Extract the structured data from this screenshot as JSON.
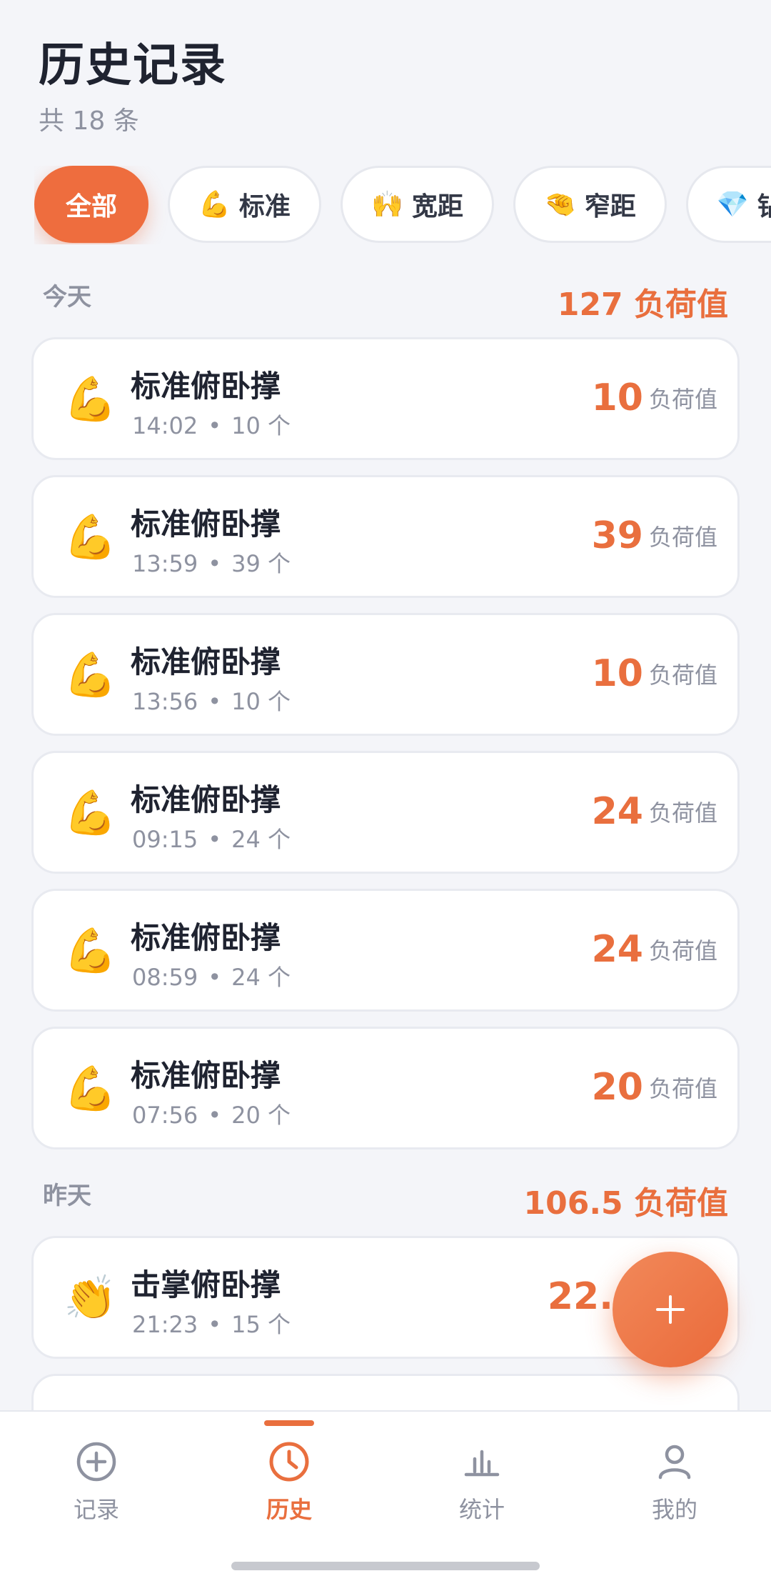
{
  "header": {
    "title": "历史记录",
    "subtitle": "共 18 条"
  },
  "filters": [
    {
      "label": "全部",
      "emoji": ""
    },
    {
      "label": "标准",
      "emoji": "💪"
    },
    {
      "label": "宽距",
      "emoji": "🙌"
    },
    {
      "label": "窄距",
      "emoji": "🤏"
    },
    {
      "label": "钻",
      "emoji": "💎"
    }
  ],
  "groups": [
    {
      "label": "今天",
      "total": "127 负荷值",
      "records": [
        {
          "emoji": "💪",
          "name": "标准俯卧撑",
          "time": "14:02",
          "count": "10 个",
          "value": "10",
          "unit": "负荷值"
        },
        {
          "emoji": "💪",
          "name": "标准俯卧撑",
          "time": "13:59",
          "count": "39 个",
          "value": "39",
          "unit": "负荷值"
        },
        {
          "emoji": "💪",
          "name": "标准俯卧撑",
          "time": "13:56",
          "count": "10 个",
          "value": "10",
          "unit": "负荷值"
        },
        {
          "emoji": "💪",
          "name": "标准俯卧撑",
          "time": "09:15",
          "count": "24 个",
          "value": "24",
          "unit": "负荷值"
        },
        {
          "emoji": "💪",
          "name": "标准俯卧撑",
          "time": "08:59",
          "count": "24 个",
          "value": "24",
          "unit": "负荷值"
        },
        {
          "emoji": "💪",
          "name": "标准俯卧撑",
          "time": "07:56",
          "count": "20 个",
          "value": "20",
          "unit": "负荷值"
        }
      ]
    },
    {
      "label": "昨天",
      "total": "106.5 负荷值",
      "records": [
        {
          "emoji": "👏",
          "name": "击掌俯卧撑",
          "time": "21:23",
          "count": "15 个",
          "value": "22.",
          "unit": ""
        }
      ]
    }
  ],
  "separator": "•",
  "fab": {
    "icon": "plus-icon"
  },
  "tabbar": {
    "tabs": [
      {
        "label": "记录",
        "icon": "plus-circle-icon"
      },
      {
        "label": "历史",
        "icon": "clock-icon",
        "active": true
      },
      {
        "label": "统计",
        "icon": "bar-chart-icon"
      },
      {
        "label": "我的",
        "icon": "user-icon"
      }
    ]
  },
  "colors": {
    "accent": "#e96f3e",
    "muted": "#8e92a0",
    "background": "#f4f5f9"
  }
}
